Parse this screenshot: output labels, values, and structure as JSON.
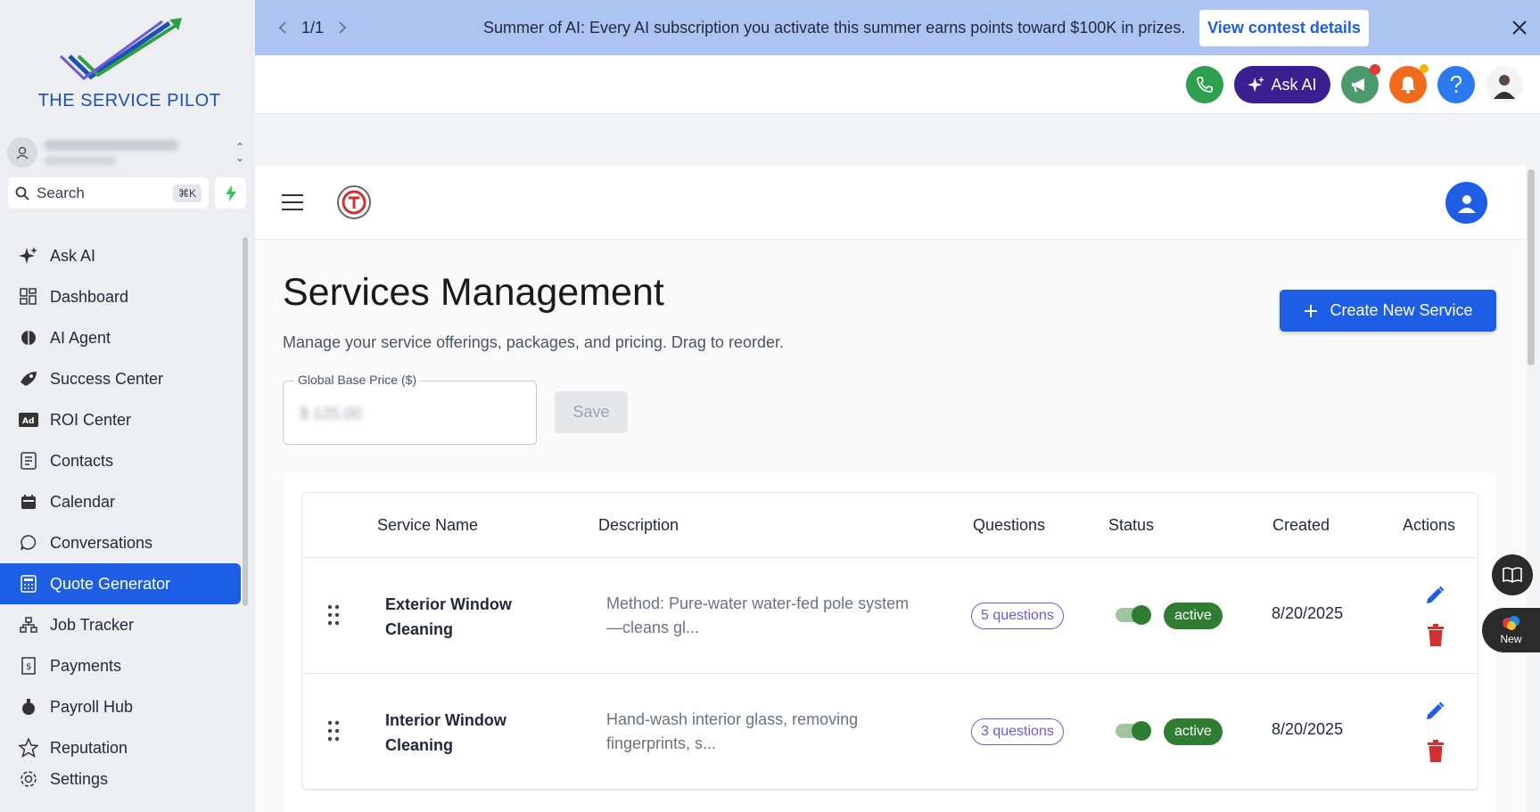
{
  "sidebar": {
    "brand": "THE SERVICE PILOT",
    "search_label": "Search",
    "search_shortcut": "⌘K",
    "items": [
      {
        "label": "Ask AI",
        "icon": "sparkle-icon"
      },
      {
        "label": "Dashboard",
        "icon": "grid-icon"
      },
      {
        "label": "AI Agent",
        "icon": "brain-icon"
      },
      {
        "label": "Success Center",
        "icon": "rocket-icon"
      },
      {
        "label": "ROI Center",
        "icon": "ad-icon"
      },
      {
        "label": "Contacts",
        "icon": "contacts-icon"
      },
      {
        "label": "Calendar",
        "icon": "calendar-icon"
      },
      {
        "label": "Conversations",
        "icon": "chat-icon"
      },
      {
        "label": "Quote Generator",
        "icon": "calculator-icon",
        "active": true
      },
      {
        "label": "Job Tracker",
        "icon": "sitemap-icon"
      },
      {
        "label": "Payments",
        "icon": "receipt-icon"
      },
      {
        "label": "Payroll Hub",
        "icon": "payroll-icon"
      },
      {
        "label": "Reputation",
        "icon": "star-icon"
      }
    ],
    "settings_label": "Settings"
  },
  "banner": {
    "pager": "1/1",
    "text": "Summer of AI: Every AI subscription you activate this summer earns points toward $100K in prizes.",
    "cta": "View contest details"
  },
  "topbar": {
    "ask_ai_label": "Ask AI"
  },
  "main": {
    "title": "Services Management",
    "subtitle": "Manage your service offerings, packages, and pricing. Drag to reorder.",
    "create_label": "Create New Service",
    "price_label": "Global Base Price ($)",
    "price_value": "$ 125.00",
    "save_label": "Save",
    "columns": [
      "Service Name",
      "Description",
      "Questions",
      "Status",
      "Created",
      "Actions"
    ],
    "rows": [
      {
        "name": "Exterior Window Cleaning",
        "description": "Method: Pure-water water-fed pole system —cleans gl...",
        "questions": "5 questions",
        "status": "active",
        "created": "8/20/2025"
      },
      {
        "name": "Interior Window Cleaning",
        "description": "Hand-wash interior glass, removing fingerprints, s...",
        "questions": "3 questions",
        "status": "active",
        "created": "8/20/2025"
      }
    ]
  },
  "floating": {
    "new_label": "New"
  },
  "colors": {
    "accent": "#1d5ee4",
    "banner_bg": "#adc4f2",
    "active_green": "#2e7d32",
    "delete_red": "#d32f2f",
    "question_purple": "#6d5ad8"
  }
}
